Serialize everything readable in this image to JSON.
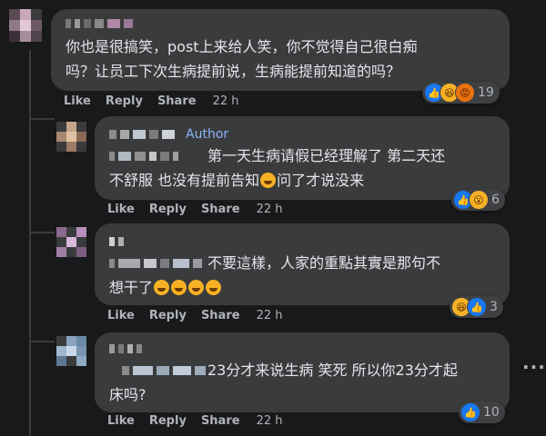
{
  "comments": [
    {
      "text_lines": [
        "你也是很搞笑，post上来给人笑，你不觉得自己很白痴",
        "吗？让员工下次生病提前说，生病能提前知道的吗？"
      ],
      "actions": {
        "like": "Like",
        "reply": "Reply",
        "share": "Share",
        "time": "22 h"
      },
      "reactions": {
        "icons": [
          "like-icon",
          "haha-icon",
          "angry-icon"
        ],
        "count": "19"
      }
    },
    {
      "badge": "Author",
      "text_lines": [
        "第一天生病请假已经理解了 第二天还",
        "不舒服 也没有提前告知",
        "问了才说没来"
      ],
      "actions": {
        "like": "Like",
        "reply": "Reply",
        "share": "Share",
        "time": "22 h"
      },
      "reactions": {
        "icons": [
          "like-icon",
          "wow-icon"
        ],
        "count": "6"
      }
    },
    {
      "text_lines": [
        "不要這樣，人家的重點其實是那句不",
        "想干了"
      ],
      "actions": {
        "like": "Like",
        "reply": "Reply",
        "share": "Share",
        "time": "22 h"
      },
      "reactions": {
        "icons": [
          "haha-icon",
          "like-icon"
        ],
        "count": "3"
      }
    },
    {
      "text_lines": [
        "23分才来说生病 笑死 所以你23分才起",
        "床吗?"
      ],
      "actions": {
        "like": "Like",
        "reply": "Reply",
        "share": "Share",
        "time": "22 h"
      },
      "reactions": {
        "icons": [
          "like-icon"
        ],
        "count": "10"
      }
    }
  ],
  "colors": {
    "background": "#18191a",
    "bubble": "#3a3b3c",
    "text": "#e4e6eb",
    "secondary_text": "#b0b3b8",
    "author_badge": "#8ab4f8",
    "like_blue": "#1877f2",
    "haha_yellow": "#f7b125",
    "angry_orange": "#e9710f"
  }
}
